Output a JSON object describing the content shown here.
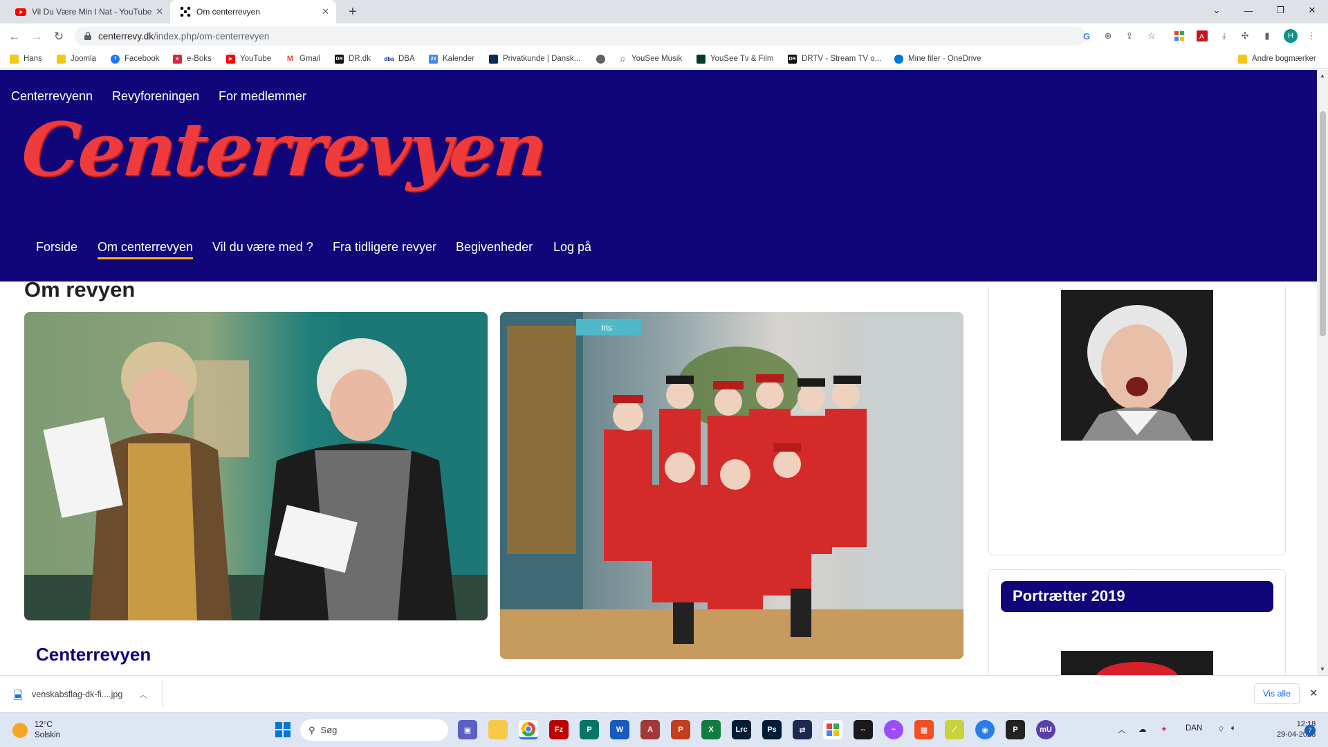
{
  "browser": {
    "tabs": [
      {
        "title": "Vil Du Være Min I Nat - YouTube",
        "icon": "youtube-icon",
        "active": false
      },
      {
        "title": "Om centerrevyen",
        "icon": "joomla-icon",
        "active": true
      }
    ],
    "new_tab": "+",
    "url_domain": "centerrevy.dk",
    "url_path": "/index.php/om-centerrevyen",
    "profile_initial": "H",
    "bookmarks": [
      {
        "label": "Hans",
        "icon": "folder-icon",
        "color": "#f5c518"
      },
      {
        "label": "Joomla",
        "icon": "folder-icon",
        "color": "#f5c518"
      },
      {
        "label": "Facebook",
        "icon": "facebook-icon",
        "color": "#1877f2"
      },
      {
        "label": "e-Boks",
        "icon": "eboks-icon",
        "color": "#d7263d"
      },
      {
        "label": "YouTube",
        "icon": "youtube-icon",
        "color": "#ff0000"
      },
      {
        "label": "Gmail",
        "icon": "gmail-icon",
        "color": "#ea4335"
      },
      {
        "label": "DR.dk",
        "icon": "dr-icon",
        "color": "#111111"
      },
      {
        "label": "DBA",
        "icon": "dba-icon",
        "color": "#0a2a8a"
      },
      {
        "label": "Kalender",
        "icon": "calendar-icon",
        "color": "#4285f4"
      },
      {
        "label": "Privatkunde | Dansk...",
        "icon": "bank-icon",
        "color": "#0c2b55"
      },
      {
        "label": "",
        "icon": "globe-icon",
        "color": "#5f6368"
      },
      {
        "label": "YouSee Musik",
        "icon": "music-icon",
        "color": "#3aa33a"
      },
      {
        "label": "YouSee Tv & Film",
        "icon": "tv-icon",
        "color": "#0b3b24"
      },
      {
        "label": "DRTV - Stream TV o...",
        "icon": "drtv-icon",
        "color": "#111111"
      },
      {
        "label": "Mine filer - OneDrive",
        "icon": "onedrive-icon",
        "color": "#0078d4"
      }
    ],
    "other_bookmarks": "Andre bogmærker"
  },
  "site": {
    "top_menu": [
      "Centerrevyenn",
      "Revyforeningen",
      "For medlemmer"
    ],
    "logo_text": "Centerrevyen",
    "main_menu": [
      "Forside",
      "Om centerrevyen",
      "Vil du være med ?",
      "Fra tidligere revyer",
      "Begivenheder",
      "Log på"
    ],
    "active_menu": "Om centerrevyen",
    "page_title": "Om revyen",
    "photo2_sign": "Iris",
    "section_title": "Centerrevyen",
    "sidebar_heading": "Portrætter 2019",
    "gallery_controls": {
      "first": "⏮",
      "prev": "⏪",
      "next": "⏩",
      "last": "⏭"
    },
    "colors": {
      "header_bg": "#10067a",
      "logo": "#ef3b3b",
      "active_underline": "#ffb619"
    }
  },
  "download_bar": {
    "file_name": "venskabsflag-dk-fi....jpg",
    "show_all": "Vis alle"
  },
  "taskbar": {
    "weather_temp": "12°C",
    "weather_desc": "Solskin",
    "search_placeholder": "Søg",
    "language": "DAN",
    "time": "12:18",
    "date": "29-04-2023",
    "notifications": "7"
  }
}
